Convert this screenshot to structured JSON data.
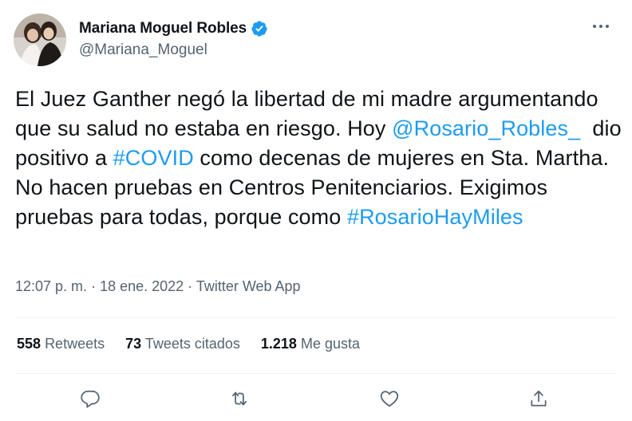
{
  "author": {
    "display_name": "Mariana Moguel Robles",
    "handle": "@Mariana_Moguel",
    "verified": true
  },
  "tweet": {
    "parts": [
      {
        "text": "El Juez Ganther negó la libertad de mi madre argumentando que su salud no estaba en riesgo. Hoy ",
        "link": false
      },
      {
        "text": "@Rosario_Robles_",
        "link": true
      },
      {
        "text": "  dio positivo a ",
        "link": false
      },
      {
        "text": "#COVID",
        "link": true
      },
      {
        "text": " como decenas de mujeres en Sta. Martha. No hacen pruebas en Centros Penitenciarios. Exigimos pruebas para todas, porque como ",
        "link": false
      },
      {
        "text": "#RosarioHayMiles",
        "link": true
      }
    ]
  },
  "meta": {
    "time": "12:07 p. m.",
    "sep1": " · ",
    "date": "18 ene. 2022",
    "sep2": " · ",
    "source": "Twitter Web App"
  },
  "stats": {
    "retweets_count": "558",
    "retweets_label": "Retweets",
    "quotes_count": "73",
    "quotes_label": "Tweets citados",
    "likes_count": "1.218",
    "likes_label": "Me gusta"
  },
  "icons": {
    "reply": "reply-icon",
    "retweet": "retweet-icon",
    "like": "like-icon",
    "share": "share-icon",
    "more": "more-icon",
    "verified": "verified-badge-icon"
  },
  "colors": {
    "link": "#1d9bf0",
    "secondary": "#536471",
    "text": "#0f1419"
  }
}
